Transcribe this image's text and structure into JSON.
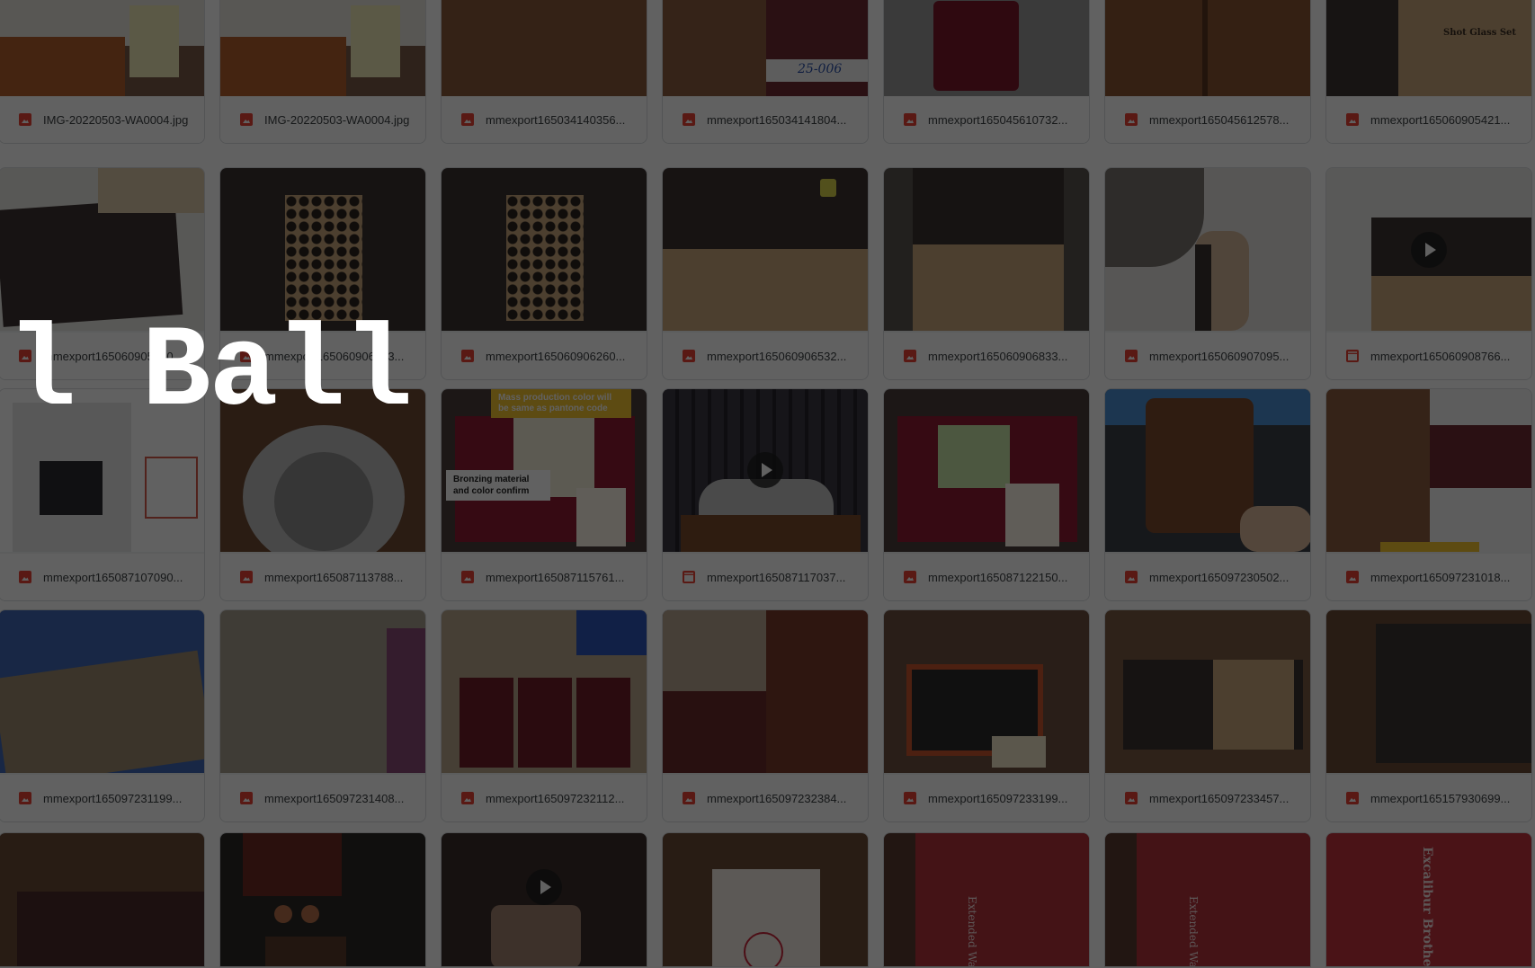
{
  "overlay_text": "l Ball",
  "colors": {
    "image_icon": "#ea4335",
    "video_icon": "#ea4335",
    "overlay": "rgba(0,0,0,0.62)"
  },
  "rows": [
    {
      "items": [
        {
          "name": "IMG-20220503-WA0004.jpg",
          "type": "image",
          "icon": "image-file-icon"
        },
        {
          "name": "IMG-20220503-WA0004.jpg",
          "type": "image",
          "icon": "image-file-icon"
        },
        {
          "name": "mmexport165034140356...",
          "type": "image",
          "icon": "image-file-icon"
        },
        {
          "name": "mmexport165034141804...",
          "type": "image",
          "icon": "image-file-icon"
        },
        {
          "name": "mmexport165045610732...",
          "type": "image",
          "icon": "image-file-icon"
        },
        {
          "name": "mmexport165045612578...",
          "type": "image",
          "icon": "image-file-icon"
        },
        {
          "name": "mmexport165060905421...",
          "type": "image",
          "icon": "image-file-icon"
        }
      ]
    },
    {
      "items": [
        {
          "name": "mmexport165060905660...",
          "type": "image",
          "icon": "image-file-icon"
        },
        {
          "name": "mmexport165060906063...",
          "type": "image",
          "icon": "image-file-icon"
        },
        {
          "name": "mmexport165060906260...",
          "type": "image",
          "icon": "image-file-icon"
        },
        {
          "name": "mmexport165060906532...",
          "type": "image",
          "icon": "image-file-icon"
        },
        {
          "name": "mmexport165060906833...",
          "type": "image",
          "icon": "image-file-icon"
        },
        {
          "name": "mmexport165060907095...",
          "type": "image",
          "icon": "image-file-icon"
        },
        {
          "name": "mmexport165060908766...",
          "type": "video",
          "icon": "video-file-icon"
        }
      ]
    },
    {
      "items": [
        {
          "name": "mmexport165087107090...",
          "type": "image",
          "icon": "image-file-icon"
        },
        {
          "name": "mmexport165087113788...",
          "type": "image",
          "icon": "image-file-icon"
        },
        {
          "name": "mmexport165087115761...",
          "type": "image",
          "icon": "image-file-icon"
        },
        {
          "name": "mmexport165087117037...",
          "type": "video",
          "icon": "video-file-icon"
        },
        {
          "name": "mmexport165087122150...",
          "type": "image",
          "icon": "image-file-icon"
        },
        {
          "name": "mmexport165097230502...",
          "type": "image",
          "icon": "image-file-icon"
        },
        {
          "name": "mmexport165097231018...",
          "type": "image",
          "icon": "image-file-icon"
        }
      ]
    },
    {
      "items": [
        {
          "name": "mmexport165097231199...",
          "type": "image",
          "icon": "image-file-icon"
        },
        {
          "name": "mmexport165097231408...",
          "type": "image",
          "icon": "image-file-icon"
        },
        {
          "name": "mmexport165097232112...",
          "type": "image",
          "icon": "image-file-icon"
        },
        {
          "name": "mmexport165097232384...",
          "type": "image",
          "icon": "image-file-icon"
        },
        {
          "name": "mmexport165097233199...",
          "type": "image",
          "icon": "image-file-icon"
        },
        {
          "name": "mmexport165097233457...",
          "type": "image",
          "icon": "image-file-icon"
        },
        {
          "name": "mmexport165157930699...",
          "type": "image",
          "icon": "image-file-icon"
        }
      ]
    }
  ],
  "annotations": {
    "bronzing": "Bronzing material and color confirm",
    "production": "Mass production color will be same as pantone code",
    "shot_glass_set": "Shot Glass Set",
    "handwritten_code": "25-006",
    "extended_warranty": "Extended Warranty",
    "brand_card": "Excalibur Brothers"
  }
}
